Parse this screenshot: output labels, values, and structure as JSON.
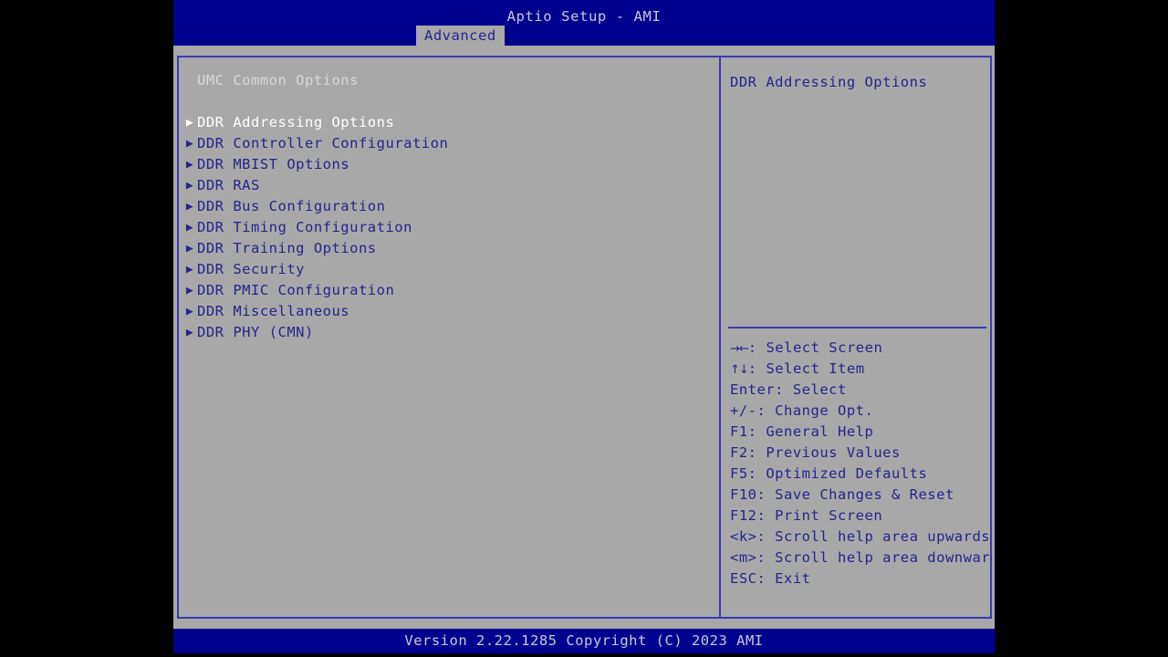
{
  "header": {
    "title": "Aptio Setup - AMI",
    "tabs": [
      {
        "label": "Advanced",
        "active": true
      }
    ]
  },
  "left_pane": {
    "section_title": "UMC Common Options",
    "items": [
      {
        "label": "DDR Addressing Options",
        "icon": "triangle-right-icon",
        "selected": true
      },
      {
        "label": "DDR Controller Configuration",
        "icon": "triangle-right-icon",
        "selected": false
      },
      {
        "label": "DDR MBIST Options",
        "icon": "triangle-right-icon",
        "selected": false
      },
      {
        "label": "DDR RAS",
        "icon": "triangle-right-icon",
        "selected": false
      },
      {
        "label": "DDR Bus Configuration",
        "icon": "triangle-right-icon",
        "selected": false
      },
      {
        "label": "DDR Timing Configuration",
        "icon": "triangle-right-icon",
        "selected": false
      },
      {
        "label": "DDR Training Options",
        "icon": "triangle-right-icon",
        "selected": false
      },
      {
        "label": "DDR Security",
        "icon": "triangle-right-icon",
        "selected": false
      },
      {
        "label": "DDR PMIC Configuration",
        "icon": "triangle-right-icon",
        "selected": false
      },
      {
        "label": "DDR Miscellaneous",
        "icon": "triangle-right-icon",
        "selected": false
      },
      {
        "label": "DDR PHY (CMN)",
        "icon": "triangle-right-icon",
        "selected": false
      }
    ]
  },
  "right_pane": {
    "help_text": "DDR Addressing Options",
    "legend": [
      {
        "keys": "→←",
        "desc": ": Select Screen",
        "icon": "left-right-arrow-icon"
      },
      {
        "keys": "↑↓",
        "desc": ": Select Item",
        "icon": "up-down-arrow-icon"
      },
      {
        "keys": "Enter",
        "desc": ": Select",
        "icon": ""
      },
      {
        "keys": "+/-",
        "desc": ": Change Opt.",
        "icon": ""
      },
      {
        "keys": "F1",
        "desc": ": General Help",
        "icon": ""
      },
      {
        "keys": "F2",
        "desc": ": Previous Values",
        "icon": ""
      },
      {
        "keys": "F5",
        "desc": ": Optimized Defaults",
        "icon": ""
      },
      {
        "keys": "F10",
        "desc": ": Save Changes & Reset",
        "icon": ""
      },
      {
        "keys": "F12",
        "desc": ": Print Screen",
        "icon": ""
      },
      {
        "keys": "<k>",
        "desc": ": Scroll help area upwards",
        "icon": ""
      },
      {
        "keys": "<m>",
        "desc": ": Scroll help area downwards",
        "icon": ""
      },
      {
        "keys": "ESC",
        "desc": ": Exit",
        "icon": ""
      }
    ]
  },
  "footer": {
    "version_text": "Version 2.22.1285 Copyright (C) 2023 AMI"
  },
  "colors": {
    "header_blue": "#00008f",
    "panel_gray": "#a8a8a8",
    "text_blue": "#25258c",
    "border_blue": "#3b3bb0",
    "selected_white": "#ffffff",
    "header_text": "#c8c8d8"
  }
}
